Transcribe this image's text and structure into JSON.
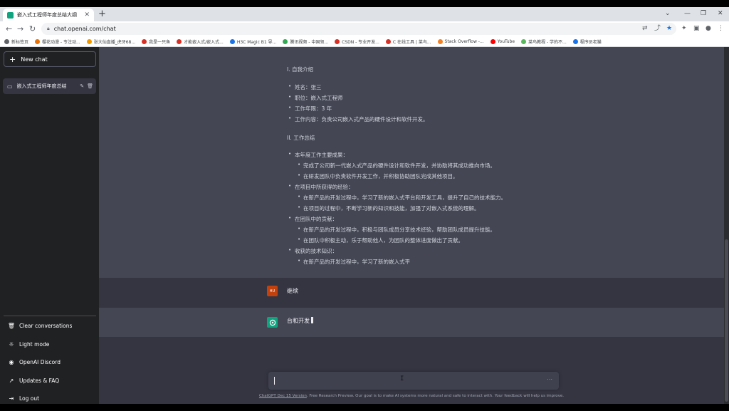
{
  "browser": {
    "tab_title": "嵌入式工程师年度总结大纲",
    "url": "chat.openai.com/chat",
    "bookmarks": [
      {
        "label": "新标签页",
        "color": "#5f6368"
      },
      {
        "label": "樱花动漫 - 专注动...",
        "color": "#e8710a"
      },
      {
        "label": "张大仙直播_虎牙68...",
        "color": "#f29900"
      },
      {
        "label": "我是一只鱼",
        "color": "#d93025"
      },
      {
        "label": "才能嵌入式/嵌入式...",
        "color": "#d93025"
      },
      {
        "label": "H3C Magic B1 导...",
        "color": "#1a73e8"
      },
      {
        "label": "腾讯视频 - 中国领...",
        "color": "#34a853"
      },
      {
        "label": "CSDN - 专业开发...",
        "color": "#d93025"
      },
      {
        "label": "C 在线工具 | 菜鸟...",
        "color": "#d93025"
      },
      {
        "label": "Stack Overflow -...",
        "color": "#f48024"
      },
      {
        "label": "YouTube",
        "color": "#ff0000"
      },
      {
        "label": "菜鸟教程 - 学的不...",
        "color": "#5cb85c"
      },
      {
        "label": "程序员老猫",
        "color": "#1a73e8"
      }
    ]
  },
  "sidebar": {
    "new_chat": "New chat",
    "conversation": "嵌入式工程师年度总结",
    "items": [
      {
        "label": "Clear conversations",
        "icon": "trash-icon"
      },
      {
        "label": "Light mode",
        "icon": "sun-icon"
      },
      {
        "label": "OpenAI Discord",
        "icon": "discord-icon"
      },
      {
        "label": "Updates & FAQ",
        "icon": "external-link-icon"
      },
      {
        "label": "Log out",
        "icon": "logout-icon"
      }
    ]
  },
  "answer": {
    "h1": "I. 自我介绍",
    "intro": [
      "姓名：张三",
      "职位：嵌入式工程师",
      "工作年限：3 年",
      "工作内容：负责公司嵌入式产品的硬件设计和软件开发。"
    ],
    "h2": "II. 工作总结",
    "sections": [
      {
        "title": "本年度工作主要成果：",
        "items": [
          "完成了公司新一代嵌入式产品的硬件设计和软件开发，并协助将其成功推向市场。",
          "在研发团队中负责软件开发工作，并积极协助团队完成其他项目。"
        ]
      },
      {
        "title": "在项目中所获得的经验：",
        "items": [
          "在新产品的开发过程中，学习了新的嵌入式平台和开发工具，提升了自己的技术能力。",
          "在项目的过程中，不断学习新的知识和技能，加强了对嵌入式系统的理解。"
        ]
      },
      {
        "title": "在团队中的贡献：",
        "items": [
          "在新产品的开发过程中，积极与团队成员分享技术经验，帮助团队成员提升技能。",
          "在团队中积极主动，乐于帮助他人，为团队的整体进度做出了贡献。"
        ]
      },
      {
        "title": "收获的技术知识：",
        "items": [
          "在新产品的开发过程中，学习了新的嵌入式平"
        ]
      }
    ]
  },
  "user_message": {
    "avatar": "HU",
    "text": "继续"
  },
  "assistant_message": {
    "text": "台和开发"
  },
  "composer": {
    "placeholder": ""
  },
  "footer": {
    "link": "ChatGPT Dec 15 Version",
    "text": ". Free Research Preview. Our goal is to make AI systems more natural and safe to interact with. Your feedback will help us improve."
  }
}
